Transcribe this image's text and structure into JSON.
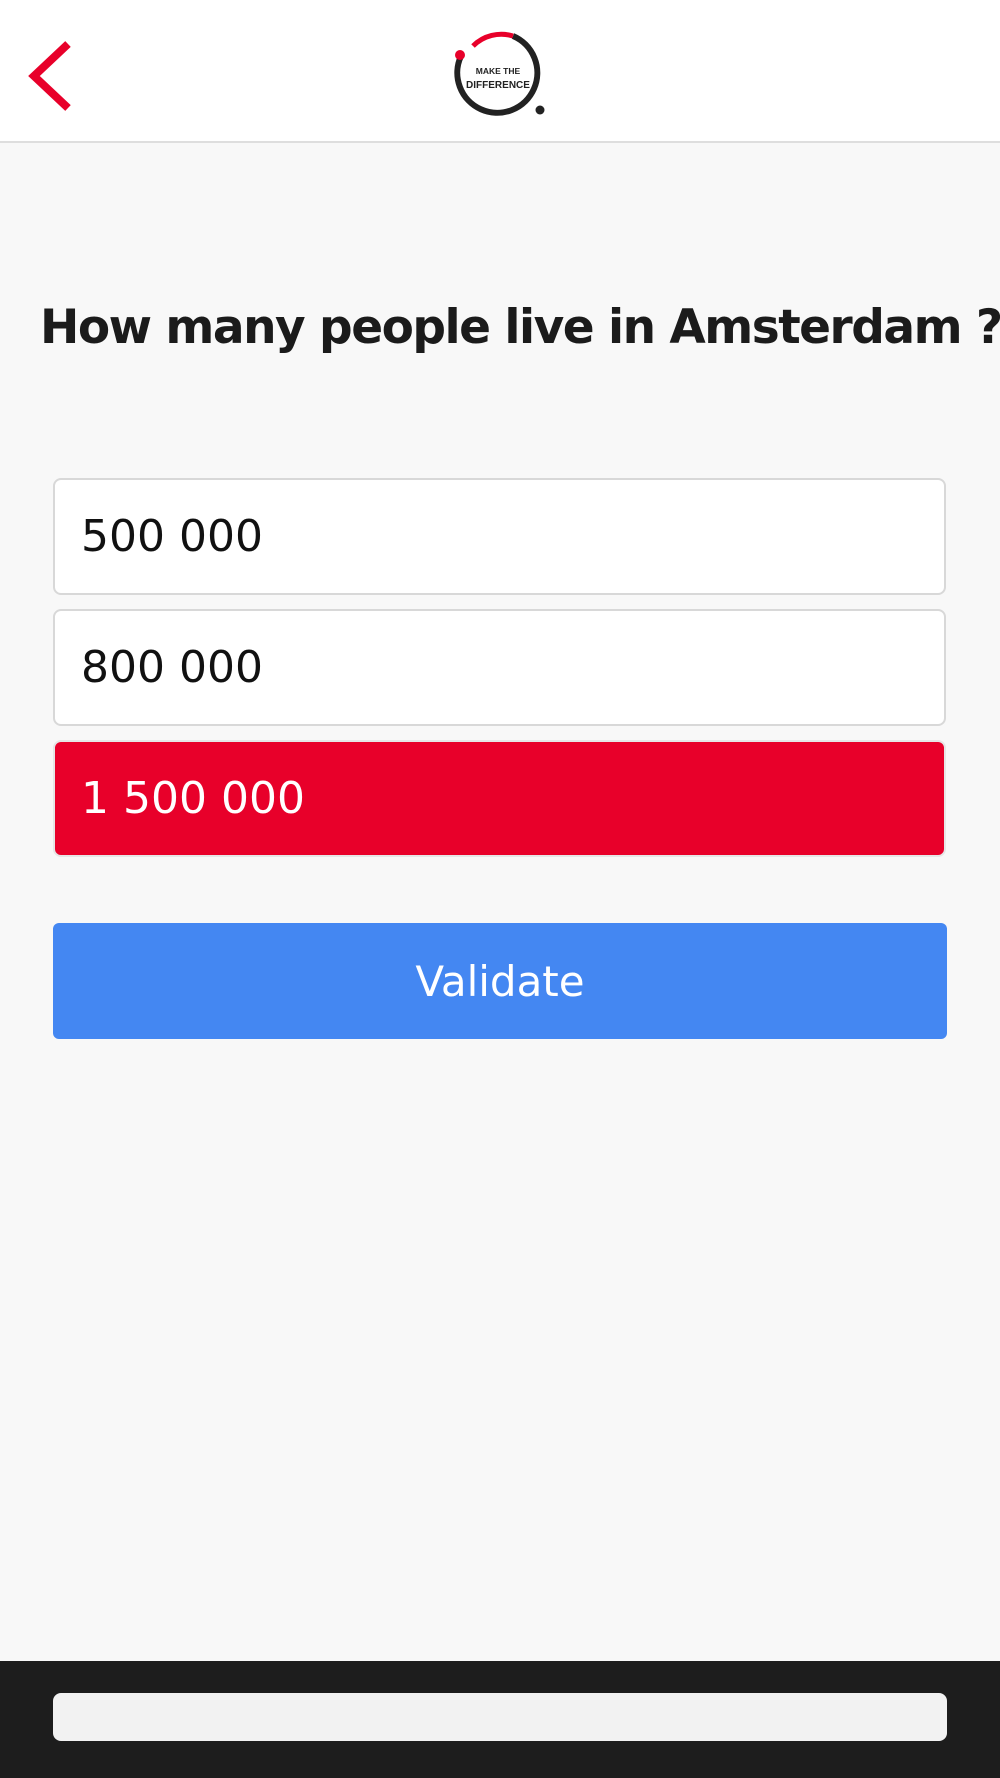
{
  "header": {
    "logo_text_top": "MAKE THE",
    "logo_text_bottom": "DIFFERENCE",
    "accent_color": "#e8002a"
  },
  "quiz": {
    "question": "How many people live in Amsterdam ?",
    "answers": [
      {
        "label": "500 000",
        "selected": false
      },
      {
        "label": "800 000",
        "selected": false
      },
      {
        "label": "1 500 000",
        "selected": true
      }
    ],
    "validate_label": "Validate",
    "validate_color": "#4487f2"
  },
  "icons": {
    "back": "chevron-left-icon",
    "logo": "make-the-difference-logo"
  }
}
